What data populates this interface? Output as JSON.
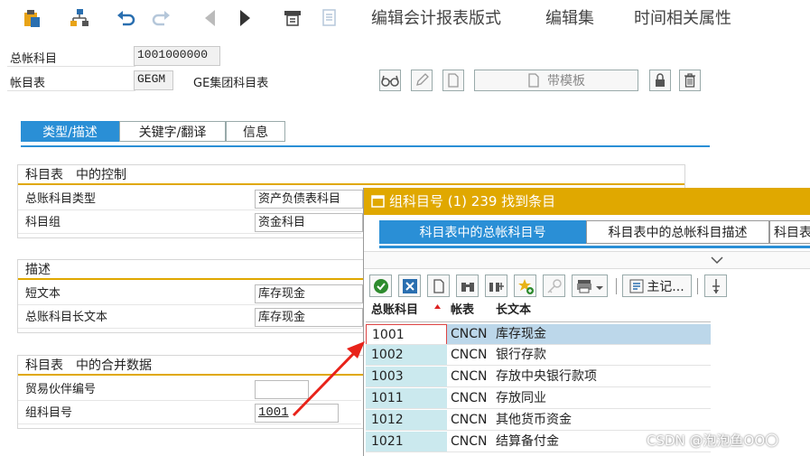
{
  "toolbar": {
    "menu_items": [
      "编辑会计报表版式",
      "编辑集",
      "时间相关属性"
    ]
  },
  "header": {
    "gl_account_label": "总帐科目",
    "gl_account_value": "1001000000",
    "chart_label": "帐目表",
    "chart_value": "GEGM",
    "chart_desc": "GE集团科目表",
    "template_button": "带模板"
  },
  "tabs": [
    "类型/描述",
    "关键字/翻译",
    "信息"
  ],
  "groups": {
    "control": {
      "title": "科目表　中的控制",
      "fields": [
        {
          "label": "总账科目类型",
          "value": "资产负债表科目"
        },
        {
          "label": "科目组",
          "value": "资金科目"
        }
      ]
    },
    "desc": {
      "title": "描述",
      "fields": [
        {
          "label": "短文本",
          "value": "库存现金"
        },
        {
          "label": "总账科目长文本",
          "value": "库存现金"
        }
      ]
    },
    "consol": {
      "title": "科目表　中的合并数据",
      "fields": [
        {
          "label": "贸易伙伴编号",
          "value": ""
        },
        {
          "label": "组科目号",
          "value": "1001"
        }
      ]
    }
  },
  "popup": {
    "title": "组科目号 (1)  239 找到条目",
    "tabs": [
      "科目表中的总帐科目号",
      "科目表中的总帐科目描述",
      "科目表"
    ],
    "toolbar_main": "主记...",
    "columns": [
      "总账科目",
      "帐表",
      "长文本"
    ],
    "rows": [
      {
        "account": "1001",
        "chart": "CNCN",
        "text": "库存现金"
      },
      {
        "account": "1002",
        "chart": "CNCN",
        "text": "银行存款"
      },
      {
        "account": "1003",
        "chart": "CNCN",
        "text": "存放中央银行款项"
      },
      {
        "account": "1011",
        "chart": "CNCN",
        "text": "存放同业"
      },
      {
        "account": "1012",
        "chart": "CNCN",
        "text": "其他货币资金"
      },
      {
        "account": "1021",
        "chart": "CNCN",
        "text": "结算备付金"
      }
    ]
  },
  "watermark": "CSDN @泡泡鱼OO〇",
  "colors": {
    "accent_blue": "#2a8fd6",
    "gold": "#e0a800",
    "arrow_red": "#e8231a",
    "key_cell": "#cbe9ee"
  }
}
